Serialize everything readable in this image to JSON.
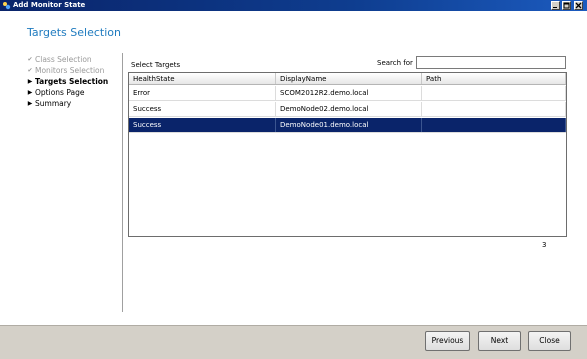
{
  "window": {
    "title": "Add Monitor State"
  },
  "page": {
    "heading": "Targets Selection"
  },
  "nav": {
    "items": [
      {
        "label": "Class Selection",
        "state": "done"
      },
      {
        "label": "Monitors Selection",
        "state": "done"
      },
      {
        "label": "Targets Selection",
        "state": "current"
      },
      {
        "label": "Options Page",
        "state": "pending"
      },
      {
        "label": "Summary",
        "state": "pending"
      }
    ]
  },
  "targets": {
    "label": "Select Targets",
    "search_label": "Search for",
    "search_value": "",
    "columns": [
      "HealthState",
      "DisplayName",
      "Path"
    ],
    "rows": [
      {
        "health": "Error",
        "name": "SCOM2012R2.demo.local",
        "path": ""
      },
      {
        "health": "Success",
        "name": "DemoNode02.demo.local",
        "path": ""
      },
      {
        "health": "Success",
        "name": "DemoNode01.demo.local",
        "path": "",
        "selected": true
      }
    ],
    "count": "3"
  },
  "buttons": {
    "previous": "Previous",
    "next": "Next",
    "close": "Close"
  },
  "colors": {
    "selection": "#0a246a",
    "heading": "#1f7bbf",
    "titlebar": "#0a246a"
  }
}
